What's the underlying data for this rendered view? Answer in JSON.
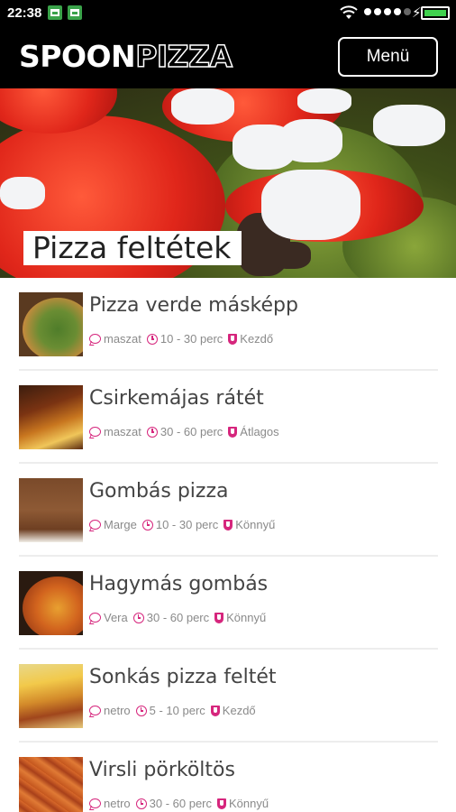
{
  "status_bar": {
    "time": "22:38",
    "icons": [
      "notification-icon",
      "notification-icon",
      "wifi-icon",
      "signal-icon",
      "charging-icon",
      "battery-icon"
    ],
    "battery_color": "#3fd14e"
  },
  "header": {
    "logo_part1": "SPOON",
    "logo_part2": "PIZZA",
    "menu_label": "Menü",
    "background": "#000000"
  },
  "hero": {
    "title": "Pizza feltétek"
  },
  "accent_color": "#d6267d",
  "recipes": [
    {
      "title": "Pizza verde másképp",
      "author": "maszat",
      "time": "10 - 30 perc",
      "difficulty": "Kezdő",
      "thumb": "green-pizza"
    },
    {
      "title": "Csirkemájas rátét",
      "author": "maszat",
      "time": "30 - 60 perc",
      "difficulty": "Átlagos",
      "thumb": "liver-pizza"
    },
    {
      "title": "Gombás pizza",
      "author": "Marge",
      "time": "10 - 30 perc",
      "difficulty": "Könnyű",
      "thumb": "mushroom-pizza"
    },
    {
      "title": "Hagymás gombás",
      "author": "Vera",
      "time": "30 - 60 perc",
      "difficulty": "Könnyű",
      "thumb": "onion-pizza"
    },
    {
      "title": "Sonkás pizza feltét",
      "author": "netro",
      "time": "5 - 10 perc",
      "difficulty": "Kezdő",
      "thumb": "ham-pizza"
    },
    {
      "title": "Virsli pörköltös",
      "author": "netro",
      "time": "30 - 60 perc",
      "difficulty": "Könnyű",
      "thumb": "sausage-dish"
    }
  ]
}
